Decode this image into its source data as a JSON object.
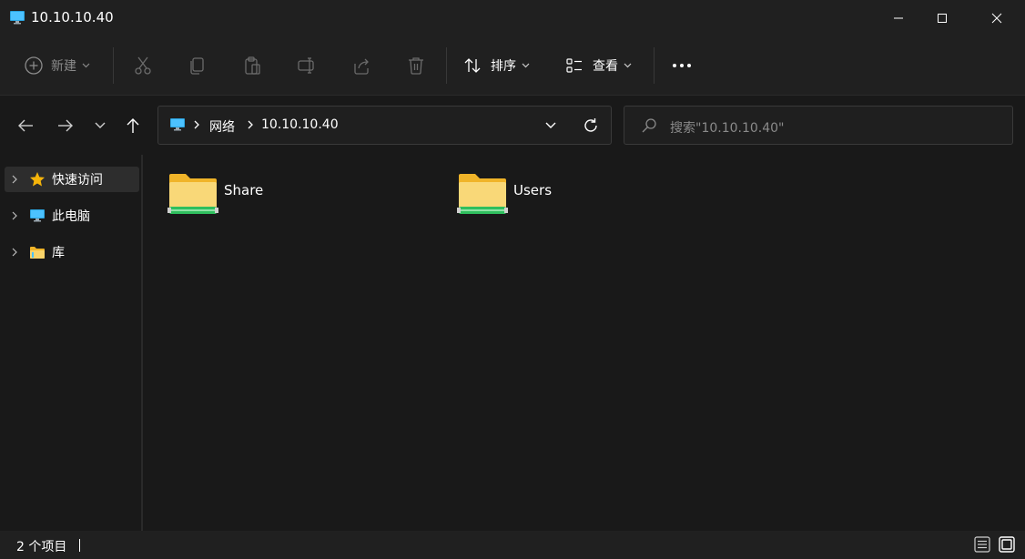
{
  "window": {
    "title": "10.10.10.40",
    "icon": "network-computer-icon",
    "controls": [
      "minimize",
      "maximize",
      "close"
    ]
  },
  "toolbar": {
    "new_label": "新建",
    "actions": [
      "cut",
      "copy",
      "paste",
      "rename",
      "share",
      "delete"
    ],
    "sort_label": "排序",
    "view_label": "查看",
    "more": "more-options-icon"
  },
  "address": {
    "segments": [
      "网络",
      "10.10.10.40"
    ]
  },
  "search": {
    "placeholder": "搜索\"10.10.10.40\""
  },
  "sidebar": {
    "items": [
      {
        "label": "快速访问",
        "icon": "star-icon",
        "selected": true
      },
      {
        "label": "此电脑",
        "icon": "computer-icon",
        "selected": false
      },
      {
        "label": "库",
        "icon": "library-folder-icon",
        "selected": false
      }
    ]
  },
  "content": {
    "items": [
      {
        "label": "Share",
        "icon": "shared-folder-icon"
      },
      {
        "label": "Users",
        "icon": "shared-folder-icon"
      }
    ]
  },
  "status": {
    "count_text": "2 个项目"
  },
  "colors": {
    "accent": "#4cc2ff",
    "folder_yellow": "#f7c94a",
    "share_green": "#2fbf5e",
    "star": "#f5b40a"
  }
}
